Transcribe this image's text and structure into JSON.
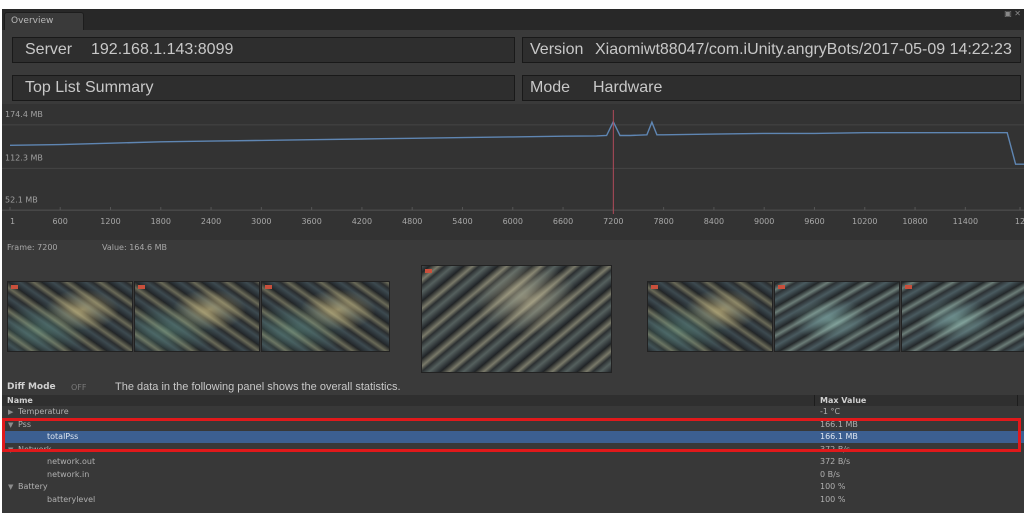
{
  "window": {
    "tab_label": "Overview",
    "controls": "▣ ✕"
  },
  "info": {
    "server_label": "Server",
    "server_value": "192.168.1.143:8099",
    "version_label": "Version",
    "version_value": "Xiaomiwt88047/com.iUnity.angryBots/2017-05-09 14:22:23",
    "toplist_label": "Top List",
    "toplist_value": "Summary",
    "mode_label": "Mode",
    "mode_value": "Hardware"
  },
  "chart_data": {
    "type": "line",
    "y_labels": [
      "174.4 MB",
      "112.3 MB",
      "52.1 MB"
    ],
    "x_ticks": [
      "1",
      "600",
      "1200",
      "1800",
      "2400",
      "3000",
      "3600",
      "4200",
      "4800",
      "5400",
      "6000",
      "6600",
      "7200",
      "7800",
      "8400",
      "9000",
      "9600",
      "10200",
      "10800",
      "11400",
      "12"
    ],
    "x_range": [
      1,
      12100
    ],
    "y_range_mb": [
      30,
      190
    ],
    "series": [
      {
        "x": [
          1,
          600,
          1200,
          1800,
          2400,
          3000,
          3600,
          4200,
          4800,
          5400,
          6000,
          6600,
          7000,
          7120,
          7200,
          7280,
          7400,
          7600,
          7660,
          7720,
          7800,
          8400,
          9000,
          9600,
          10200,
          10800,
          11400,
          11900,
          12000,
          12100
        ],
        "y": [
          131,
          132,
          134,
          136,
          137,
          138,
          139,
          140,
          141,
          142,
          143,
          144,
          144.5,
          145,
          164.6,
          145,
          145,
          146,
          164,
          146,
          146,
          147,
          148,
          148,
          149,
          149,
          149,
          149,
          104,
          104
        ]
      }
    ],
    "selected_frame": 7200,
    "line_color": "#5f86b3",
    "marker_color": "#b04a5a"
  },
  "frame_info": {
    "frame_text": "Frame: 7200",
    "value_text": "Value: 164.6 MB"
  },
  "diff": {
    "label": "Diff Mode",
    "state": "OFF",
    "description": "The data in the following panel shows the overall statistics."
  },
  "table": {
    "col_name": "Name",
    "col_max": "Max Value",
    "rows": [
      {
        "name": "Temperature",
        "value": "-1 °C",
        "level": 0,
        "arrow": "▶"
      },
      {
        "name": "Pss",
        "value": "166.1 MB",
        "level": 0,
        "arrow": "▼"
      },
      {
        "name": "totalPss",
        "value": "166.1 MB",
        "level": 1,
        "arrow": ""
      },
      {
        "name": "Network",
        "value": "372 B/s",
        "level": 0,
        "arrow": "▼"
      },
      {
        "name": "network.out",
        "value": "372 B/s",
        "level": 1,
        "arrow": ""
      },
      {
        "name": "network.in",
        "value": "0 B/s",
        "level": 1,
        "arrow": ""
      },
      {
        "name": "Battery",
        "value": "100 %",
        "level": 0,
        "arrow": "▼"
      },
      {
        "name": "batterylevel",
        "value": "100 %",
        "level": 1,
        "arrow": ""
      }
    ]
  }
}
